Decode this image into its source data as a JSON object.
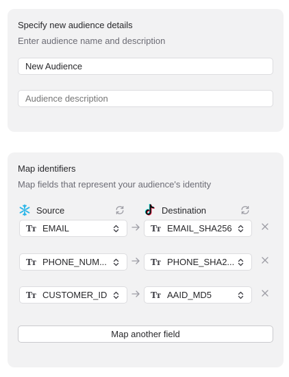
{
  "audience_details": {
    "title": "Specify new audience details",
    "subtitle": "Enter audience name and description",
    "name_value": "New Audience",
    "description_placeholder": "Audience description"
  },
  "map_identifiers": {
    "title": "Map identifiers",
    "subtitle": "Map fields that represent your audience's identity",
    "source_label": "Source",
    "destination_label": "Destination",
    "type_glyph": "Tт",
    "rows": [
      {
        "source": "EMAIL",
        "destination": "EMAIL_SHA256"
      },
      {
        "source": "PHONE_NUM...",
        "destination": "PHONE_SHA2..."
      },
      {
        "source": "CUSTOMER_ID",
        "destination": "AAID_MD5"
      }
    ],
    "map_another_label": "Map another field"
  },
  "colors": {
    "card_bg": "#f2f2f3",
    "snowflake": "#29b5e8",
    "tiktok_cyan": "#25f4ee",
    "tiktok_pink": "#fe2c55",
    "muted_icon": "#9b9ba3"
  }
}
